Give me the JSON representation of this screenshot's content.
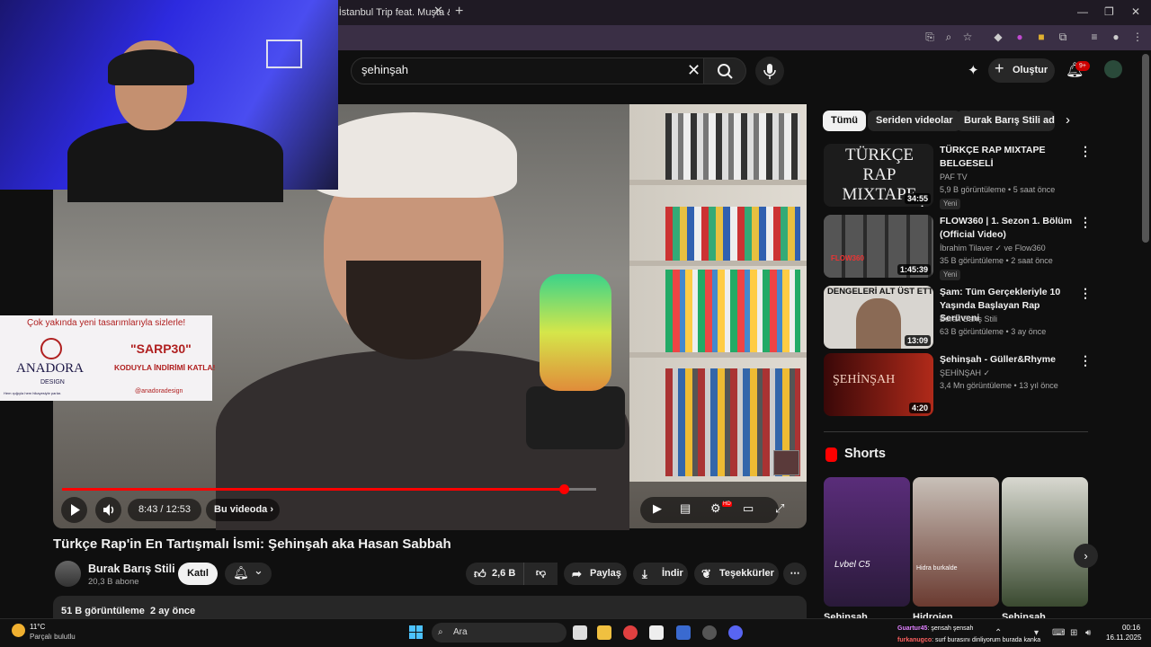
{
  "browser": {
    "tab_title": ") İstanbul Trip feat. Muşta &",
    "tab_close": "✕",
    "new_tab": "+",
    "window_minimize": "—",
    "window_restore": "❐",
    "window_close": "✕"
  },
  "header": {
    "search_value": "şehinşah",
    "create_label": "Oluştur",
    "notif_count": "9+"
  },
  "webcam_overlay": {},
  "ad_overlay": {
    "headline": "Çok yakında yeni tasarımlarıyla sizlerle!",
    "brand": "ANADORA",
    "brand_sub": "DESIGN",
    "tagline": "Hem ışığıyla hem hikayesiyle parlar.",
    "code": "\"SARP30\"",
    "cta": "KODUYLA İNDİRİMİ KATLA!",
    "handle": "@anadoradesign"
  },
  "player": {
    "progress_fraction": 0.94,
    "time": "8:43 / 12:53",
    "chapter_label": "Bu videoda",
    "hd_badge": "HD"
  },
  "video": {
    "title": "Türkçe Rap'in En Tartışmalı İsmi: Şehinşah aka Hasan Sabbah",
    "channel_name": "Burak Barış Stili",
    "subscribers": "20,3 B abone",
    "join_label": "Katıl",
    "like_count": "2,6 B",
    "share_label": "Paylaş",
    "download_label": "İndir",
    "thanks_label": "Teşekkürler",
    "views": "51 B görüntüleme",
    "age": "2 ay önce"
  },
  "chips": [
    "Tümü",
    "Seriden videolar",
    "Burak Barış Stili adlı y"
  ],
  "recommendations": [
    {
      "title": "TÜRKÇE RAP MIXTAPE BELGESELİ",
      "channel": "PAF TV",
      "meta": "5,9 B görüntüleme • 5 saat önce",
      "duration": "34:55",
      "badge": "Yeni",
      "thumb_text": "TÜRKÇE RAP MIXTAPE BELGESELİ",
      "thumb_color": "#222"
    },
    {
      "title": "FLOW360 | 1. Sezon 1. Bölüm (Official Video)",
      "channel": "İbrahim Tilaver ✓ ve Flow360",
      "meta": "35 B görüntüleme • 2 saat önce",
      "duration": "1:45:39",
      "badge": "Yeni",
      "thumb_text": "FLOW360",
      "thumb_color": "#3a3a3a"
    },
    {
      "title": "Şam: Tüm Gerçekleriyle 10 Yaşında Başlayan Rap Serüveni",
      "channel": "Burak Barış Stili",
      "meta": "63 B görüntüleme • 3 ay önce",
      "duration": "13:09",
      "badge": "",
      "thumb_text": "DENGELERİ ALT ÜST ETTİ",
      "thumb_color": "#d8d5d0"
    },
    {
      "title": "Şehinşah - Güller&Rhyme",
      "channel": "ŞEHİNŞAH ✓",
      "meta": "3,4 Mn görüntüleme • 13 yıl önce",
      "duration": "4:20",
      "badge": "",
      "thumb_text": "ŞEHİNŞAH",
      "thumb_color": "#7a1010"
    }
  ],
  "shorts": {
    "title": "Shorts",
    "items": [
      {
        "label": "Şehinşah",
        "thumb_text": "Lvbel C5",
        "color": "#3a1f5a"
      },
      {
        "label": "Hidrojen",
        "thumb_text": "Hidra burkalde",
        "color": "#6a3a30"
      },
      {
        "label": "Şehinşah",
        "thumb_text": "",
        "color": "#3a4a30"
      }
    ]
  },
  "taskbar": {
    "temp": "11°C",
    "weather": "Parçalı bulutlu",
    "search_label": "Ara",
    "chat_line1_user": "Guartur45",
    "chat_line1_msg": ": şensah şensah",
    "chat_line2_user": "furkanugco",
    "chat_line2_msg": ": surf burasını dinliyorum burada kanka",
    "time": "00:16",
    "date": "16.11.2025"
  }
}
